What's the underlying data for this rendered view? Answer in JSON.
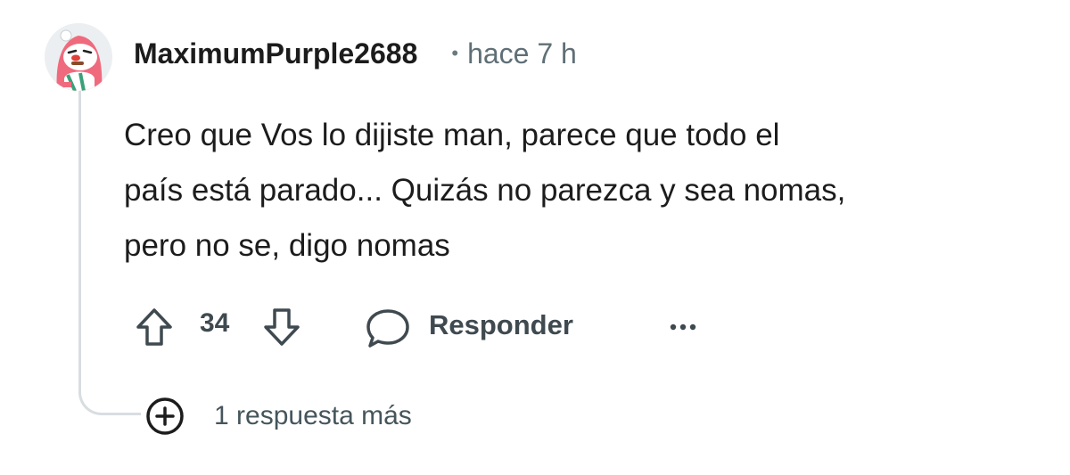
{
  "comment": {
    "username": "MaximumPurple2688",
    "separator": "•",
    "time": "hace 7 h",
    "lines": [
      "Creo que Vos lo dijiste man, parece que todo el",
      "país está parado... Quizás no parezca y sea nomas,",
      "pero no se, digo nomas"
    ],
    "avatar_icon": "snoo-avatar-pink-hood-icon"
  },
  "actions": {
    "upvote_icon": "arrow-up-icon",
    "vote_count": "34",
    "downvote_icon": "arrow-down-icon",
    "reply_icon": "speech-bubble-icon",
    "reply_label": "Responder",
    "more_icon": "ellipsis-icon"
  },
  "replies": {
    "expand_icon": "plus-circle-icon",
    "label": "1 respuesta más"
  },
  "colors": {
    "thread_line": "#d8dde0",
    "text_primary": "#1c1c1c",
    "text_secondary": "#5f6f76",
    "action_text": "#3f4a50"
  }
}
